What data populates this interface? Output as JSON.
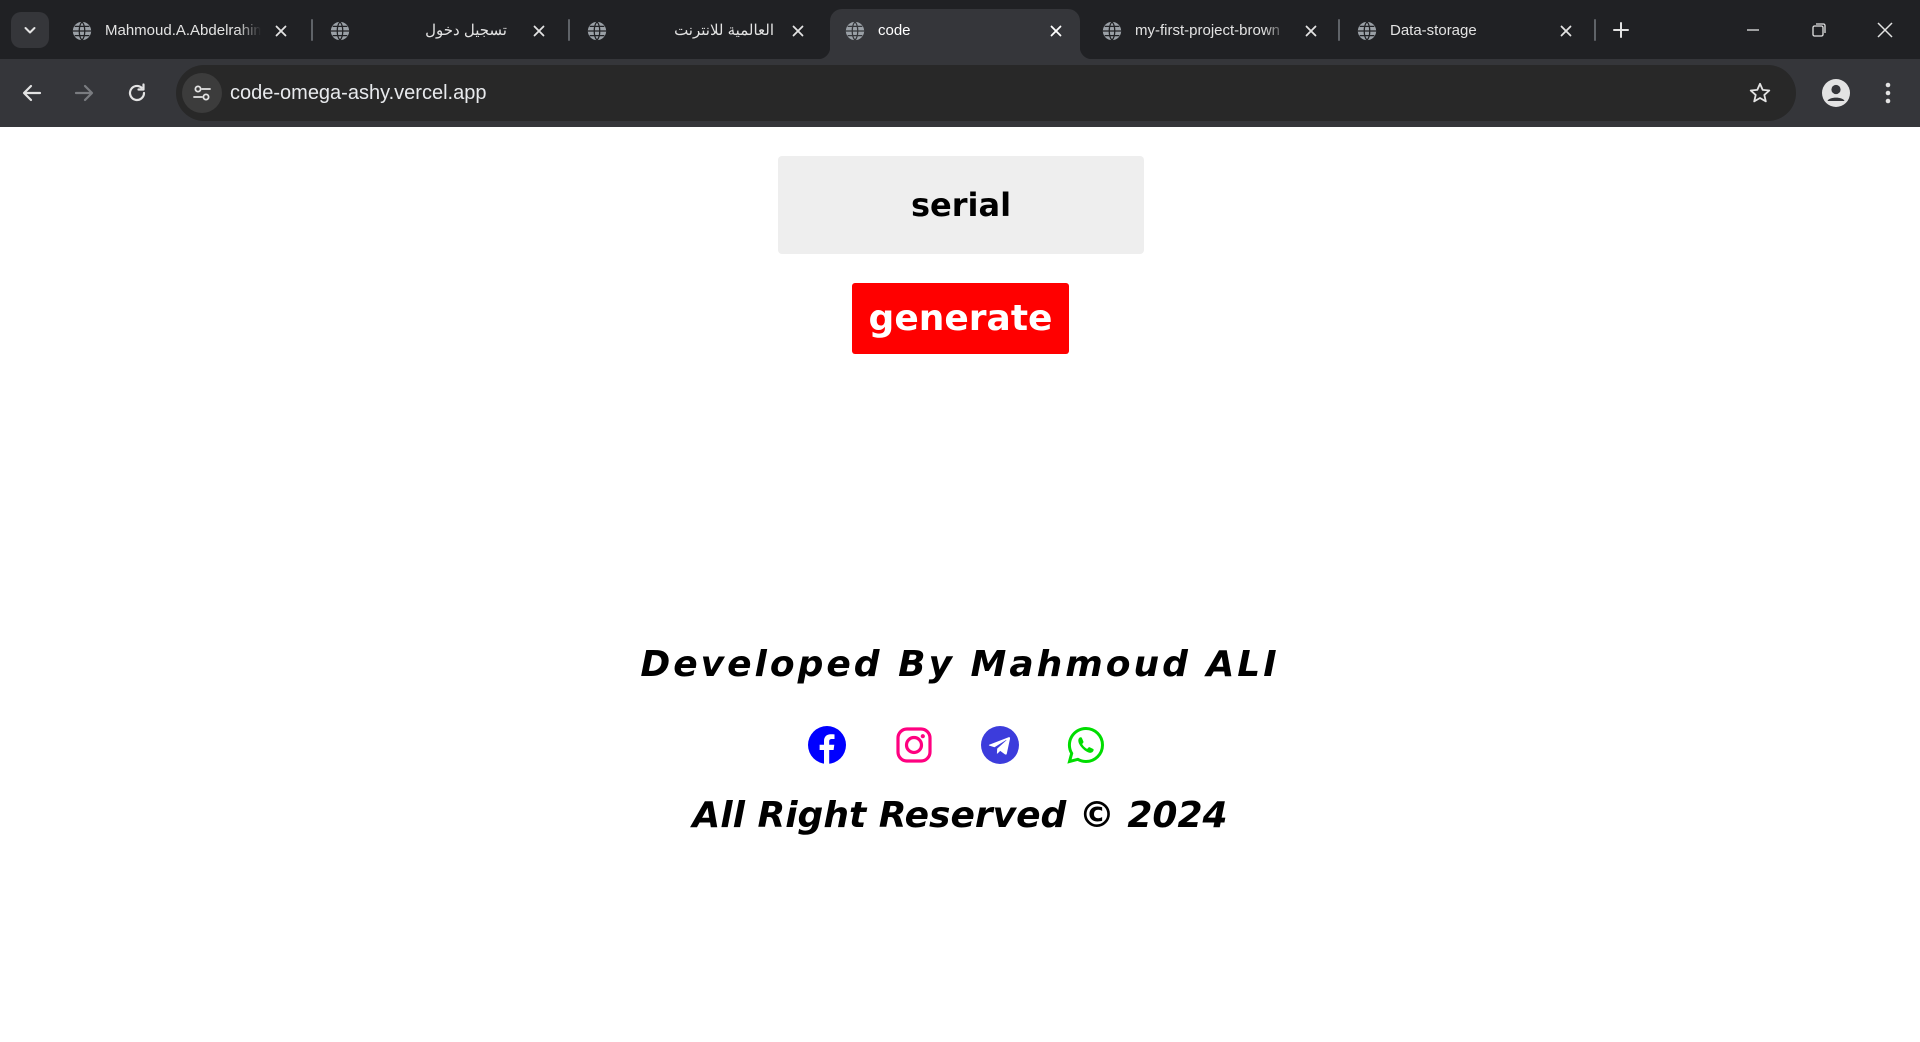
{
  "browser": {
    "tabs": [
      {
        "title": "Mahmoud.A.Abdelrahim",
        "active": false,
        "rtl": false
      },
      {
        "title": "تسجيل دخول",
        "active": false,
        "rtl": true
      },
      {
        "title": "العالمية للانترنت",
        "active": false,
        "rtl": true
      },
      {
        "title": "code",
        "active": true,
        "rtl": false
      },
      {
        "title": "my-first-project-brown",
        "active": false,
        "rtl": false
      },
      {
        "title": "Data-storage",
        "active": false,
        "rtl": false
      }
    ],
    "url": "code-omega-ashy.vercel.app",
    "icons": {
      "tab_search": "chevron-down-icon",
      "favicon": "globe-icon",
      "tab_close": "close-icon",
      "new_tab": "plus-icon",
      "back": "arrow-left-icon",
      "forward": "arrow-right-icon",
      "reload": "reload-icon",
      "site_info": "tune-icon",
      "bookmark": "star-icon",
      "profile": "person-icon",
      "menu": "kebab-menu-icon",
      "minimize": "minimize-icon",
      "restore": "restore-icon",
      "close_window": "close-icon"
    }
  },
  "form": {
    "serial_placeholder": "serial",
    "serial_value": "",
    "generate_label": "generate"
  },
  "footer": {
    "developed_by": "Developed By Mahmoud ALI",
    "rights": "All Right Reserved © 2024",
    "socials": [
      {
        "name": "facebook",
        "color": "#0000ff"
      },
      {
        "name": "instagram",
        "color": "#ff0080"
      },
      {
        "name": "telegram",
        "color": "#3c3cdc"
      },
      {
        "name": "whatsapp",
        "color": "#00dd00"
      }
    ]
  },
  "colors": {
    "generate_bg": "#ff0000",
    "input_bg": "#eeeeee",
    "chrome_dark": "#202124",
    "chrome_toolbar": "#35363a"
  }
}
